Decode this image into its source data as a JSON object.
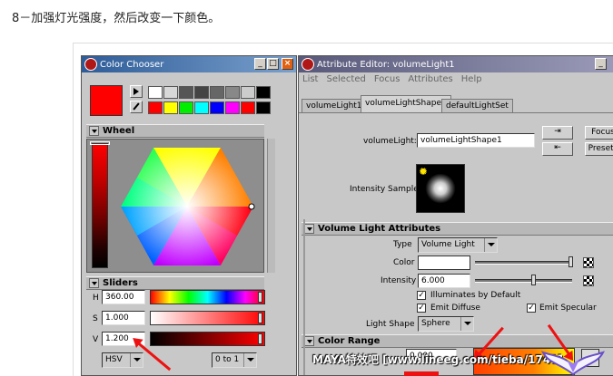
{
  "caption": "8－加强灯光强度，然后改变一下颜色。",
  "color_chooser": {
    "title": "Color Chooser",
    "title_buttons": [
      "_",
      "□",
      "×"
    ],
    "wheel_label": "Wheel",
    "sliders_label": "Sliders",
    "current_color": "#ff0000",
    "swatches_row1": [
      "#ffffff",
      "#d8d8d8",
      "#555555",
      "#444444",
      "#666666",
      "#888888",
      "#cccccc",
      "#000000"
    ],
    "swatches_row2": [
      "#ff0000",
      "#ffff00",
      "#00ee00",
      "#00ffff",
      "#0000ff",
      "#ff00ff",
      "#ff0000",
      "#000000"
    ],
    "sliders": [
      {
        "label": "H",
        "value": "360.00"
      },
      {
        "label": "S",
        "value": "1.000"
      },
      {
        "label": "V",
        "value": "1.200"
      }
    ],
    "mode_select": "HSV",
    "range_select": "0 to 1"
  },
  "attribute_editor": {
    "title": "Attribute Editor: volumeLight1",
    "menu": [
      "List",
      "Selected",
      "Focus",
      "Attributes",
      "Help"
    ],
    "tabs": [
      "volumeLight1",
      "volumeLightShape1",
      "defaultLightSet"
    ],
    "active_tab": 1,
    "node_label": "volumeLight:",
    "node_name": "volumeLightShape1",
    "focus_button": "Focus",
    "presets_button": "Presets",
    "intensity_sample_label": "Intensity Sample",
    "section_volume": "Volume Light Attributes",
    "type_label": "Type",
    "type_value": "Volume Light",
    "color_label": "Color",
    "intensity_label": "Intensity",
    "intensity_value": "6.000",
    "intensity_slider_fraction": 0.6,
    "illuminates_default": "Illuminates by Default",
    "emit_diffuse": "Emit Diffuse",
    "emit_specular": "Emit Specular",
    "check_mark": "✓",
    "light_shape_label": "Light Shape",
    "light_shape_value": "Sphere",
    "section_color_range": "Color Range",
    "partial_value": "0.000"
  },
  "watermark": "MAYA特效吧 [www.lineeg.com/tieba/1745]",
  "colors": {
    "cc_title": "#3c6ea8",
    "ae_title": "#5a5a8c",
    "annotation": "#ee1111"
  }
}
